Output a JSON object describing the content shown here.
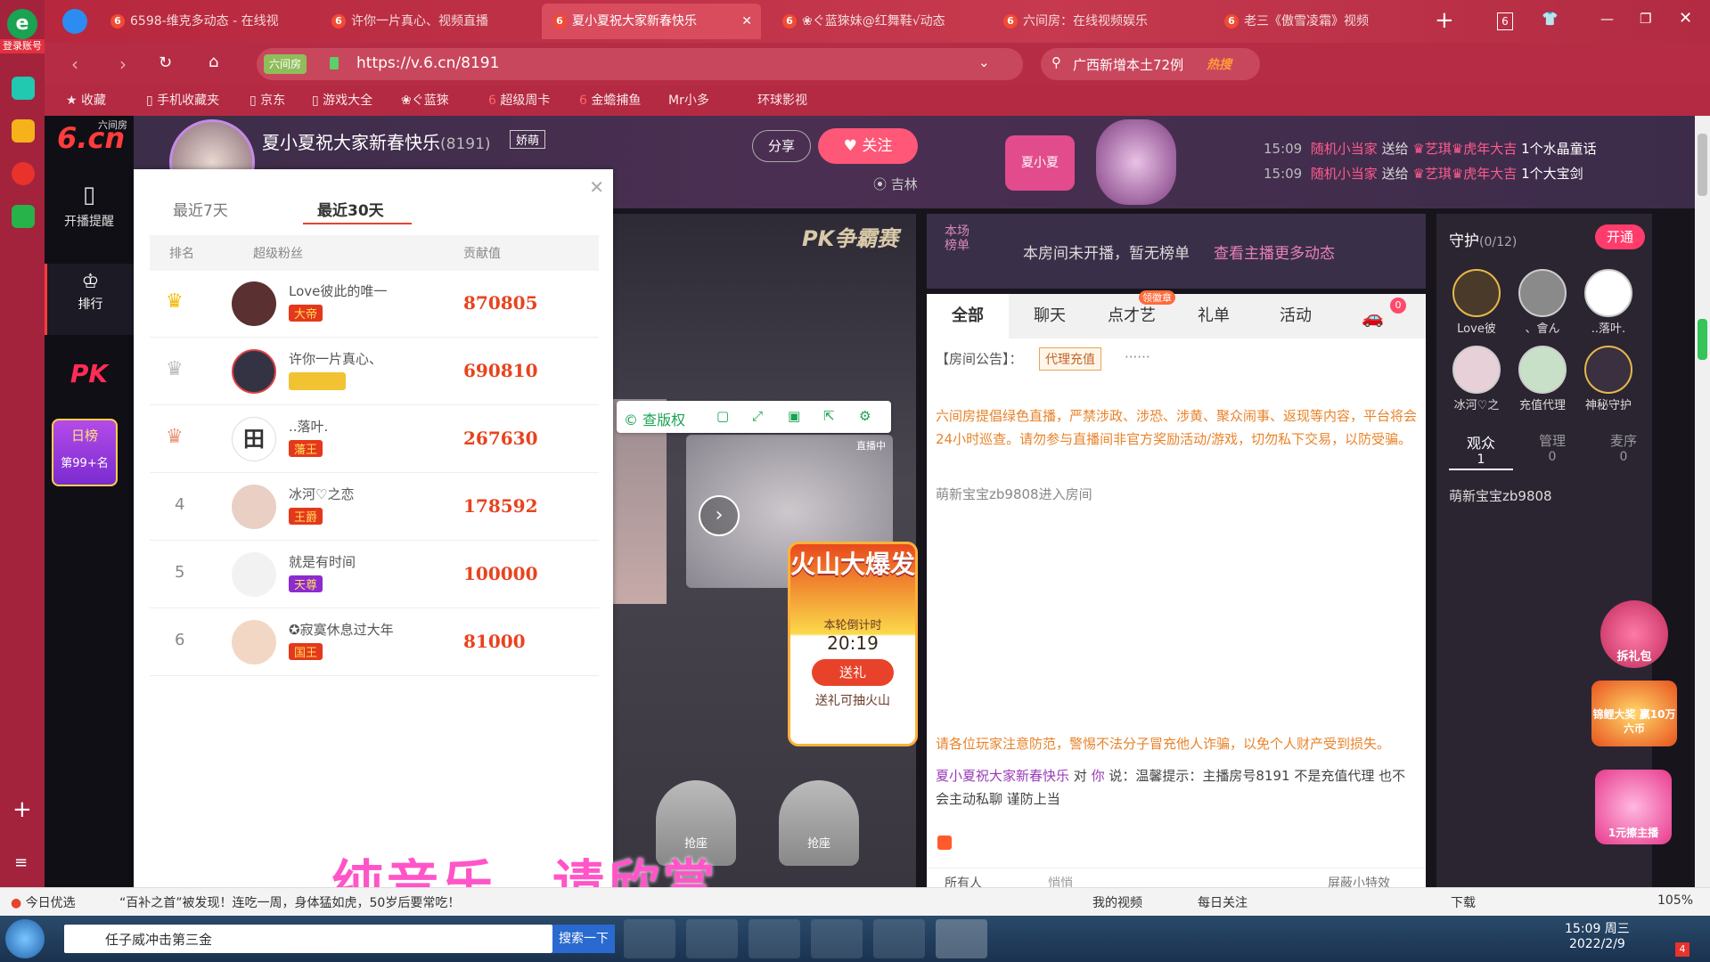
{
  "browser": {
    "login_label": "登录账号",
    "tabs": [
      {
        "title": "6598-维克多动态 - 在线视"
      },
      {
        "title": "许你一片真心、视频直播"
      },
      {
        "title": "夏小夏祝大家新春快乐"
      },
      {
        "title": "❀ぐ蓝猍妹@红舞鞋√动态"
      },
      {
        "title": "六间房：在线视频娱乐"
      },
      {
        "title": "老三《傲雪凌霜》视频"
      }
    ],
    "tab_count": "6",
    "site_badge": "六间房",
    "url": "https://v.6.cn/8191",
    "search_text": "广西新增本土72例",
    "hot_label": "热搜",
    "bookmarks": [
      "收藏",
      "手机收藏夹",
      "京东",
      "游戏大全",
      "❀ぐ蓝猍",
      "超级周卡",
      "金蟾捕鱼",
      "Mr小多",
      "环球影视"
    ]
  },
  "site": {
    "logo_text": "6.cn",
    "logo_sub": "六间房",
    "nav": [
      {
        "label": "开播提醒"
      },
      {
        "label": "排行"
      },
      {
        "label": "PK"
      }
    ],
    "day_rank_title": "日榜",
    "day_rank_value": "第99+名"
  },
  "room": {
    "title": "夏小夏祝大家新春快乐",
    "room_id": "(8191)",
    "tag": "娇萌",
    "share_label": "分享",
    "follow_label": "关注",
    "location": "吉林",
    "badge_name": "夏小夏",
    "gift_feed": [
      {
        "time": "15:09",
        "from": "随机小当家",
        "verb": "送给",
        "to": "♛艺琪♛虎年大吉",
        "gift": "1个水晶童话"
      },
      {
        "time": "15:09",
        "from": "随机小当家",
        "verb": "送给",
        "to": "♛艺琪♛虎年大吉",
        "gift": "1个大宝剑"
      }
    ]
  },
  "rank_popup": {
    "tabs": [
      "最近7天",
      "最近30天"
    ],
    "active_tab": 1,
    "columns": [
      "排名",
      "超级粉丝",
      "贡献值"
    ],
    "rows": [
      {
        "rank": "1",
        "name": "Love彼此的唯一",
        "badge": "大帝",
        "value": "870805"
      },
      {
        "rank": "2",
        "name": "许你一片真心、",
        "badge": "",
        "value": "690810"
      },
      {
        "rank": "3",
        "name": "..落叶.",
        "badge": "藩王",
        "value": "267630"
      },
      {
        "rank": "4",
        "name": "冰河♡之恋",
        "badge": "王爵",
        "value": "178592"
      },
      {
        "rank": "5",
        "name": "就是有时间",
        "badge": "天尊",
        "value": "100000"
      },
      {
        "rank": "6",
        "name": "✪寂寞休息过大年",
        "badge": "国王",
        "value": "81000"
      }
    ]
  },
  "stage": {
    "pk_title": "PK争霸赛",
    "video_toolbar_label": "查版权",
    "live_tag": "直播中",
    "event_title": "火山大爆发",
    "countdown_label": "本轮倒计时",
    "countdown": "20:19",
    "send_gift_label": "送礼",
    "event_sub": "送礼可抽火山",
    "seat1": "抢座",
    "seat2": "抢座",
    "overlay_text": "纯音乐，请欣赏"
  },
  "chat": {
    "board_label": "本场榜单",
    "board_empty": "本房间未开播，暂无榜单",
    "board_link": "查看主播更多动态",
    "tabs": [
      "全部",
      "聊天",
      "点才艺",
      "礼单",
      "活动"
    ],
    "talent_badge": "领徽章",
    "car_count": "0",
    "notice_label": "【房间公告】：",
    "notice_tag": "代理充值",
    "notice_more": "······",
    "warning": "六间房提倡绿色直播，严禁涉政、涉恐、涉黄、聚众闹事、返现等内容，平台将会24小时巡查。请勿参与直播间非官方奖励活动/游戏，切勿私下交易，以防受骗。",
    "enter_msg": "萌新宝宝zb9808进入房间",
    "bottom_warning": "请各位玩家注意防范，警惕不法分子冒充他人诈骗，以免个人财产受到损失。",
    "host_name": "夏小夏祝大家新春快乐",
    "host_mid": "对",
    "host_you": "你",
    "host_say": "说：温馨提示：主播房号8191 不是充值代理 也不会主动私聊 谨防上当",
    "to_label": "所有人",
    "whisper_label": "悄悄",
    "block_label": "屏蔽小特效"
  },
  "guard": {
    "title": "守护",
    "count": "(0/12)",
    "open_label": "开通",
    "members": [
      {
        "name": "Love彼"
      },
      {
        "name": "、會ん"
      },
      {
        "name": "..落叶."
      },
      {
        "name": "冰河♡之"
      },
      {
        "name": "充值代理"
      },
      {
        "name": "神秘守护"
      }
    ],
    "tabs": [
      {
        "label": "观众",
        "count": "1"
      },
      {
        "label": "管理",
        "count": "0"
      },
      {
        "label": "麦序",
        "count": "0"
      }
    ],
    "viewer": "萌新宝宝zb9808"
  },
  "promos": [
    "拆礼包",
    "锦鲤大奖 赢10万六币",
    "1元擦主播"
  ],
  "statusbar": {
    "left": "今日优选",
    "news": "“百补之首”被发现！连吃一周，身体猛如虎，50岁后要常吃！",
    "items": [
      "我的视频",
      "每日关注",
      "下载"
    ],
    "zoom": "105%"
  },
  "taskbar": {
    "ie_text": "任子威冲击第三金",
    "search_btn": "搜索一下",
    "time": "15:09 周三",
    "date": "2022/2/9",
    "notif": "4"
  },
  "colors": {
    "brand_red": "#c6394e",
    "accent_orange": "#e8571e",
    "pink": "#ff5577"
  }
}
